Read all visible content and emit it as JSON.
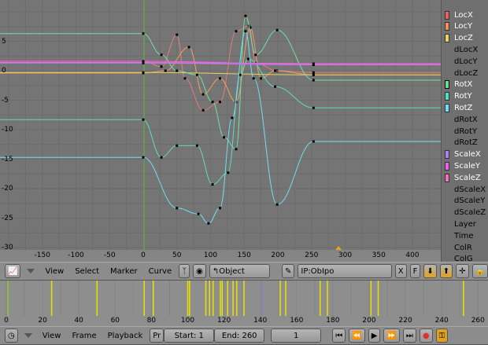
{
  "graph": {
    "y_ticks": [
      5,
      0,
      -5,
      -10,
      -15,
      -20,
      -25,
      -30
    ],
    "x_ticks": [
      -150,
      -100,
      -50,
      0,
      50,
      100,
      150,
      200,
      250,
      300,
      350,
      400
    ],
    "current_frame_line": 1,
    "curves": [
      {
        "channel": "LocX",
        "color": "#e87a7a",
        "keys": [
          [
            0,
            1.6
          ],
          [
            27,
            0.7
          ],
          [
            50,
            6.1
          ],
          [
            62,
            -1.3
          ],
          [
            89,
            -6.7
          ],
          [
            114,
            -5.3
          ],
          [
            138,
            6.7
          ],
          [
            157,
            7.6
          ],
          [
            167,
            1.3
          ],
          [
            199,
            0
          ],
          [
            253,
            -0.3
          ]
        ]
      },
      {
        "channel": "LocY",
        "color": "#f0a060",
        "keys": [
          [
            0,
            -0.4
          ],
          [
            33,
            0
          ],
          [
            68,
            4
          ],
          [
            89,
            -4
          ],
          [
            114,
            -1.3
          ],
          [
            138,
            -5.3
          ],
          [
            159,
            7.3
          ],
          [
            175,
            -1.3
          ],
          [
            196,
            0
          ],
          [
            253,
            -0.7
          ]
        ]
      },
      {
        "channel": "LocZ",
        "color": "#e8d060",
        "keys": [
          [
            0,
            -0.3
          ],
          [
            253,
            -0.7
          ]
        ]
      },
      {
        "channel": "RotX",
        "color": "#70e0a0",
        "keys": [
          [
            0,
            6.3
          ],
          [
            27,
            2.7
          ],
          [
            50,
            0
          ],
          [
            80,
            -0.7
          ],
          [
            103,
            -5.3
          ],
          [
            120,
            -11.3
          ],
          [
            138,
            -13.3
          ],
          [
            152,
            9.3
          ],
          [
            167,
            2.7
          ],
          [
            199,
            6.9
          ],
          [
            253,
            -1.6
          ]
        ]
      },
      {
        "channel": "RotY",
        "color": "#60dcc0",
        "keys": [
          [
            0,
            -8.3
          ],
          [
            27,
            -14.7
          ],
          [
            50,
            -12.7
          ],
          [
            80,
            -12.7
          ],
          [
            103,
            -19.3
          ],
          [
            126,
            -17.3
          ],
          [
            144,
            -0.7
          ],
          [
            156,
            2
          ],
          [
            196,
            -2.7
          ],
          [
            253,
            -6.3
          ]
        ]
      },
      {
        "channel": "RotZ",
        "color": "#70e0f0",
        "keys": [
          [
            0,
            -14.7
          ],
          [
            50,
            -23.3
          ],
          [
            82,
            -24.3
          ],
          [
            97,
            -25.9
          ],
          [
            114,
            -23.3
          ],
          [
            132,
            -8
          ],
          [
            152,
            6.7
          ],
          [
            164,
            -1.3
          ],
          [
            199,
            -22.7
          ],
          [
            253,
            -12
          ]
        ]
      },
      {
        "channel": "ScaleX",
        "color": "#b080f0",
        "keys": [
          [
            0,
            1.3
          ],
          [
            253,
            1.0
          ]
        ]
      },
      {
        "channel": "ScaleZ",
        "color": "#f070c0",
        "keys": [
          [
            0,
            1.4
          ],
          [
            253,
            1.2
          ]
        ]
      },
      {
        "channel": "ScaleY",
        "color": "#f060f0",
        "keys": [
          [
            0,
            1.6
          ],
          [
            253,
            1.1
          ]
        ]
      }
    ]
  },
  "channels": [
    {
      "label": "LocX",
      "color": "#e86060",
      "on": true
    },
    {
      "label": "LocY",
      "color": "#f09060",
      "on": true
    },
    {
      "label": "LocZ",
      "color": "#f0d060",
      "on": true
    },
    {
      "label": "dLocX"
    },
    {
      "label": "dLocY"
    },
    {
      "label": "dLocZ"
    },
    {
      "label": "RotX",
      "color": "#60e090",
      "on": true,
      "selected": true
    },
    {
      "label": "RotY",
      "color": "#50e0c0",
      "on": true
    },
    {
      "label": "RotZ",
      "color": "#70e0f0",
      "on": true
    },
    {
      "label": "dRotX"
    },
    {
      "label": "dRotY"
    },
    {
      "label": "dRotZ"
    },
    {
      "label": "ScaleX",
      "color": "#b080f0",
      "on": true
    },
    {
      "label": "ScaleY",
      "color": "#f060f0",
      "on": true
    },
    {
      "label": "ScaleZ",
      "color": "#f070c0",
      "on": true
    },
    {
      "label": "dScaleX"
    },
    {
      "label": "dScaleY"
    },
    {
      "label": "dScaleZ"
    },
    {
      "label": "Layer"
    },
    {
      "label": "Time"
    },
    {
      "label": "ColR"
    },
    {
      "label": "ColG"
    }
  ],
  "ipo_header": {
    "menus": [
      "View",
      "Select",
      "Marker",
      "Curve"
    ],
    "object_select": "Object",
    "ipo_name": "IP:ObIpo",
    "x_label": "X",
    "f_label": "F"
  },
  "timeline": {
    "keyframes": [
      1,
      25,
      50,
      76,
      81,
      100,
      101,
      110,
      112,
      114,
      118,
      119,
      122,
      125,
      127,
      131,
      151,
      154,
      173,
      177,
      201,
      205,
      252
    ],
    "marker_frames": [
      141
    ],
    "ruler": [
      0,
      20,
      40,
      60,
      80,
      100,
      120,
      140,
      160,
      180,
      200,
      220,
      240,
      260
    ]
  },
  "timeline_header": {
    "menus": [
      "View",
      "Frame",
      "Playback"
    ],
    "pr_label": "Pr",
    "start": "Start: 1",
    "end": "End: 260",
    "current": "1"
  }
}
